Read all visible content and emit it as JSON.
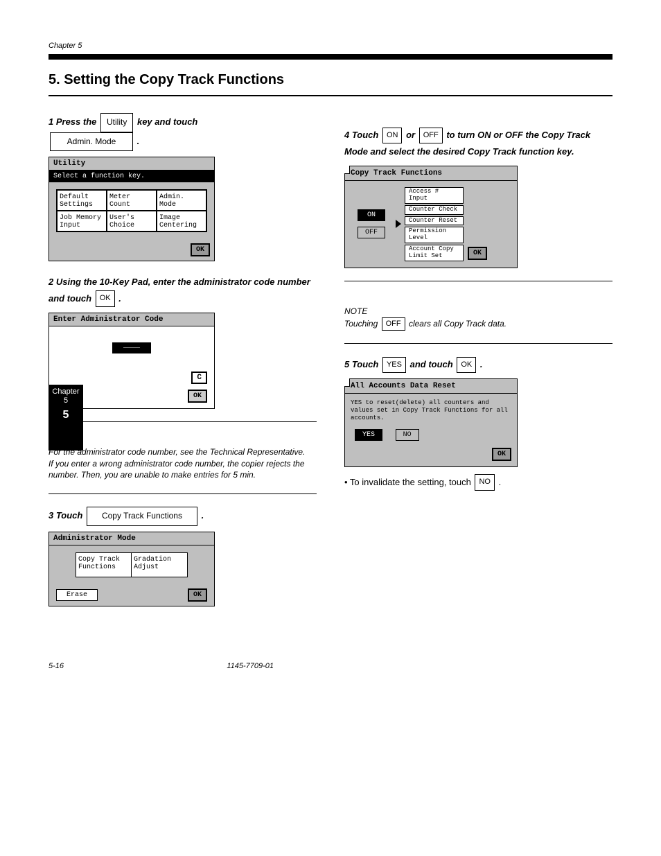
{
  "leftTab": {
    "line1": "Chapter 5",
    "line2": "5"
  },
  "header": {
    "chapterLine": "Chapter 5",
    "sectionTitle": "5. Setting the Copy Track Functions"
  },
  "left": {
    "step1": {
      "prefix": "1 Press the ",
      "btn": "Utility",
      "suffix": " key and touch ",
      "btn2": "Admin. Mode",
      "end": " ."
    },
    "panel1": {
      "title": "Utility",
      "instruction": "Select a function key.",
      "cells": [
        "Default Settings",
        "Meter Count",
        "Admin. Mode",
        "Job Memory Input",
        "User's Choice",
        "Image Centering"
      ],
      "ok": "OK"
    },
    "step2": {
      "prefix": "2 Using the 10-Key Pad, enter the administrator code number and touch ",
      "btn": "OK",
      "end": " ."
    },
    "panel2": {
      "title": "Enter Administrator Code",
      "value": "____",
      "c": "C",
      "ok": "OK"
    },
    "notes": "NOTES\nFor the administrator code number, see the Technical Representative.\nIf you enter a wrong administrator code number, the copier rejects the number. Then, you are unable to make entries for 5 min.",
    "step3": {
      "prefix": "3 Touch ",
      "btn": "Copy Track Functions",
      "end": " ."
    },
    "panel3": {
      "title": "Administrator Mode",
      "cells": [
        "Copy Track Functions",
        "Gradation Adjust"
      ],
      "erase": "Erase",
      "ok": "OK"
    }
  },
  "right": {
    "step4": {
      "prefix": "4 Touch ",
      "on": "ON",
      "or": " or ",
      "off": "OFF",
      "mid": " to turn ON or OFF the Copy Track Mode and select the desired Copy Track function key."
    },
    "panel4": {
      "title": "Copy Track Functions",
      "on": "ON",
      "off": "OFF",
      "opts": [
        "Access # Input",
        "Counter Check",
        "Counter Reset",
        "Permission Level",
        "Account Copy Limit Set"
      ],
      "ok": "OK"
    },
    "note4": "NOTE\nTouching OFF clears all Copy Track data.",
    "step5a": {
      "prefix": "5 Touch ",
      "btn": "YES",
      "mid": " and touch ",
      "btn2": "OK",
      "end": " ."
    },
    "panel5": {
      "title": "All Accounts Data Reset",
      "body": "YES to reset(delete) all counters and values set in Copy Track Functions for all accounts.",
      "yes": "YES",
      "no": "NO",
      "ok": "OK"
    },
    "step5b": {
      "prefix": "• To invalidate the setting, touch ",
      "btn": "NO",
      "end": " ."
    }
  },
  "footer": {
    "page": "5-16",
    "text": "1145-7709-01"
  }
}
